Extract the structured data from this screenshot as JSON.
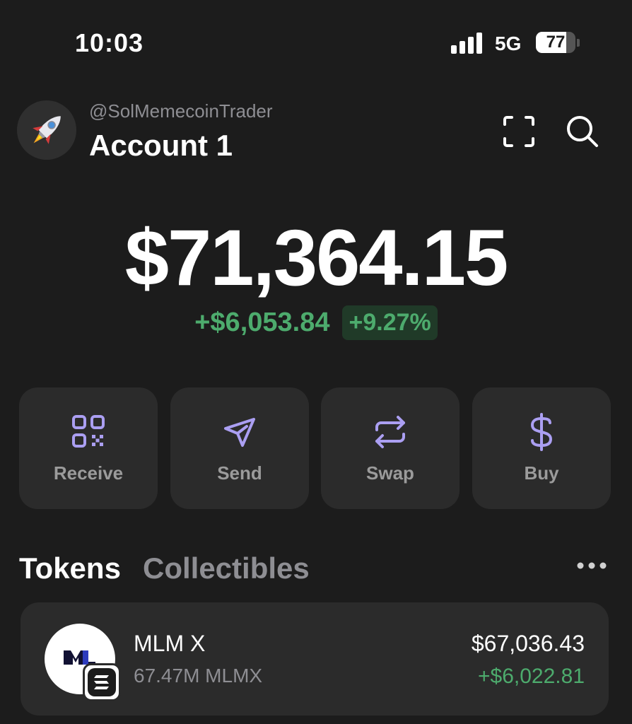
{
  "status_bar": {
    "time": "10:03",
    "network": "5G",
    "battery": "77",
    "battery_level_percent": 77
  },
  "header": {
    "username": "@SolMemecoinTrader",
    "account_name": "Account 1",
    "avatar_icon": "rocket-icon",
    "scan_icon": "scan-icon",
    "search_icon": "search-icon"
  },
  "portfolio": {
    "balance": "$71,364.15",
    "change_abs": "+$6,053.84",
    "change_pct": "+9.27%"
  },
  "actions": [
    {
      "label": "Receive",
      "icon": "qr-code-icon"
    },
    {
      "label": "Send",
      "icon": "send-icon"
    },
    {
      "label": "Swap",
      "icon": "swap-icon"
    },
    {
      "label": "Buy",
      "icon": "dollar-icon"
    }
  ],
  "tabs": {
    "tokens": "Tokens",
    "collectibles": "Collectibles",
    "more_icon": "more-dots-icon"
  },
  "tokens": [
    {
      "name": "MLM X",
      "amount": "67.47M MLMX",
      "value": "$67,036.43",
      "change": "+$6,022.81",
      "logo_icon": "mlm-logo-icon",
      "chain_icon": "solana-icon"
    }
  ],
  "colors": {
    "background": "#1c1c1c",
    "card": "#2b2b2b",
    "accent": "#ab9ff2",
    "positive": "#4dab6d",
    "muted": "#8e8e93"
  }
}
